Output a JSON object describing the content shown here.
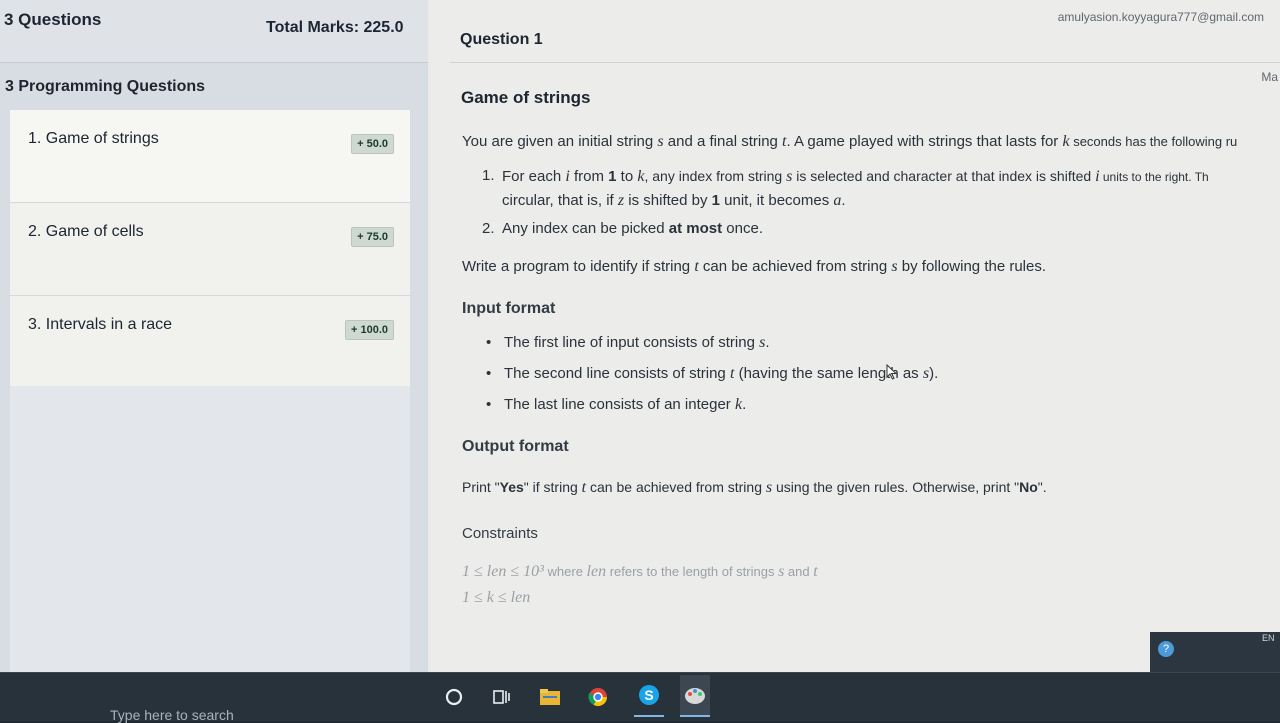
{
  "sidebar": {
    "questions_count": "3 Questions",
    "total_marks": "Total Marks: 225.0",
    "section_title": "3 Programming Questions",
    "items": [
      {
        "label": "1. Game of strings",
        "marks": "+ 50.0"
      },
      {
        "label": "2. Game of cells",
        "marks": "+ 75.0"
      },
      {
        "label": "3. Intervals in a race",
        "marks": "+ 100.0"
      }
    ]
  },
  "header": {
    "email": "amulyasion.koyyagura777@gmail.com",
    "question_label": "Question",
    "question_number": "1",
    "marks_partial": "Ma"
  },
  "problem": {
    "title": "Game of strings",
    "intro_1": "You are given an initial string ",
    "intro_s": "s",
    "intro_2": " and a final string ",
    "intro_t": "t",
    "intro_3": ". A game played with strings that lasts for ",
    "intro_k": "k",
    "intro_4": " seconds has the following ru",
    "rules": [
      {
        "num": "1.",
        "a": "For each ",
        "i": "i",
        "b": " from ",
        "one": "1",
        "c": " to ",
        "k": "k",
        "d": ", any index from string ",
        "s": "s",
        "e": " is selected and character at that index is shifted ",
        "i2": "i",
        "f": " units to the right. Th",
        "g": "circular, that is, if ",
        "z": "z",
        "h": " is shifted by ",
        "one2": "1",
        "j": " unit, it becomes ",
        "a_var": "a",
        "end": "."
      },
      {
        "num": "2.",
        "a": "Any index can be picked ",
        "bold": "at most",
        "b": " once."
      }
    ],
    "write_1": "Write a program to identify if string ",
    "write_t": "t",
    "write_2": " can be achieved from string ",
    "write_s": "s",
    "write_3": " by following the rules.",
    "input_heading": "Input format",
    "input_items": [
      {
        "a": "The first line of input consists of string ",
        "v": "s",
        "b": "."
      },
      {
        "a": "The second line consists of string ",
        "v": "t",
        "b": " (having the same length as ",
        "v2": "s",
        "c": ")."
      },
      {
        "a": "The last line consists of an integer ",
        "v": "k",
        "b": "."
      }
    ],
    "output_heading": "Output format",
    "output_1": "Print \"",
    "output_yes": "Yes",
    "output_2": "\" if string ",
    "output_t": "t",
    "output_3": " can be achieved from string ",
    "output_s": "s",
    "output_4": " using the given rules. Otherwise, print \"",
    "output_no": "No",
    "output_5": "\".",
    "constraints_heading": "Constraints",
    "constraint_1_math": "1 ≤ len ≤ 10³",
    "constraint_1_text": " where ",
    "constraint_1_len": "len",
    "constraint_1_text2": " refers to the length of strings ",
    "constraint_1_s": "s",
    "constraint_1_and": " and ",
    "constraint_1_t": "t",
    "constraint_2_math": "1 ≤ k ≤ len"
  },
  "taskbar": {
    "search_placeholder": "Type here to search",
    "tray_lang": "EN"
  }
}
